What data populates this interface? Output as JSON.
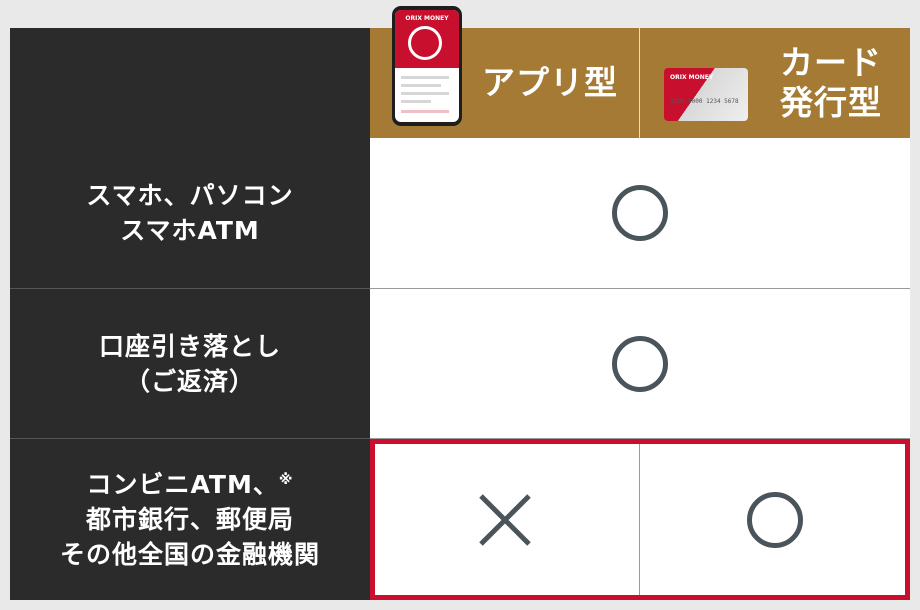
{
  "header": {
    "app_type": "アプリ型",
    "card_type_line1": "カード",
    "card_type_line2": "発行型",
    "phone_brand": "ORIX MONEY",
    "card_brand": "ORIX MONEY",
    "card_number": "2100 5000 1234 5678"
  },
  "rows": [
    {
      "label_line1": "スマホ、パソコン",
      "label_line2": "スマホATM",
      "app": "circle",
      "card": "circle",
      "merged": true
    },
    {
      "label_line1": "口座引き落とし",
      "label_line2": "（ご返済）",
      "app": "circle",
      "card": "circle",
      "merged": true
    },
    {
      "label_line1": "コンビニATM、",
      "label_note": "※",
      "label_line2": "都市銀行、郵便局",
      "label_line3": "その他全国の金融機関",
      "app": "cross",
      "card": "circle",
      "merged": false
    }
  ],
  "colors": {
    "dark": "#2b2b2b",
    "gold": "#a47a34",
    "accent_red": "#c8102e",
    "mark": "#4a545b"
  },
  "icons": {
    "circle": "circle-mark-icon",
    "cross": "cross-mark-icon"
  }
}
